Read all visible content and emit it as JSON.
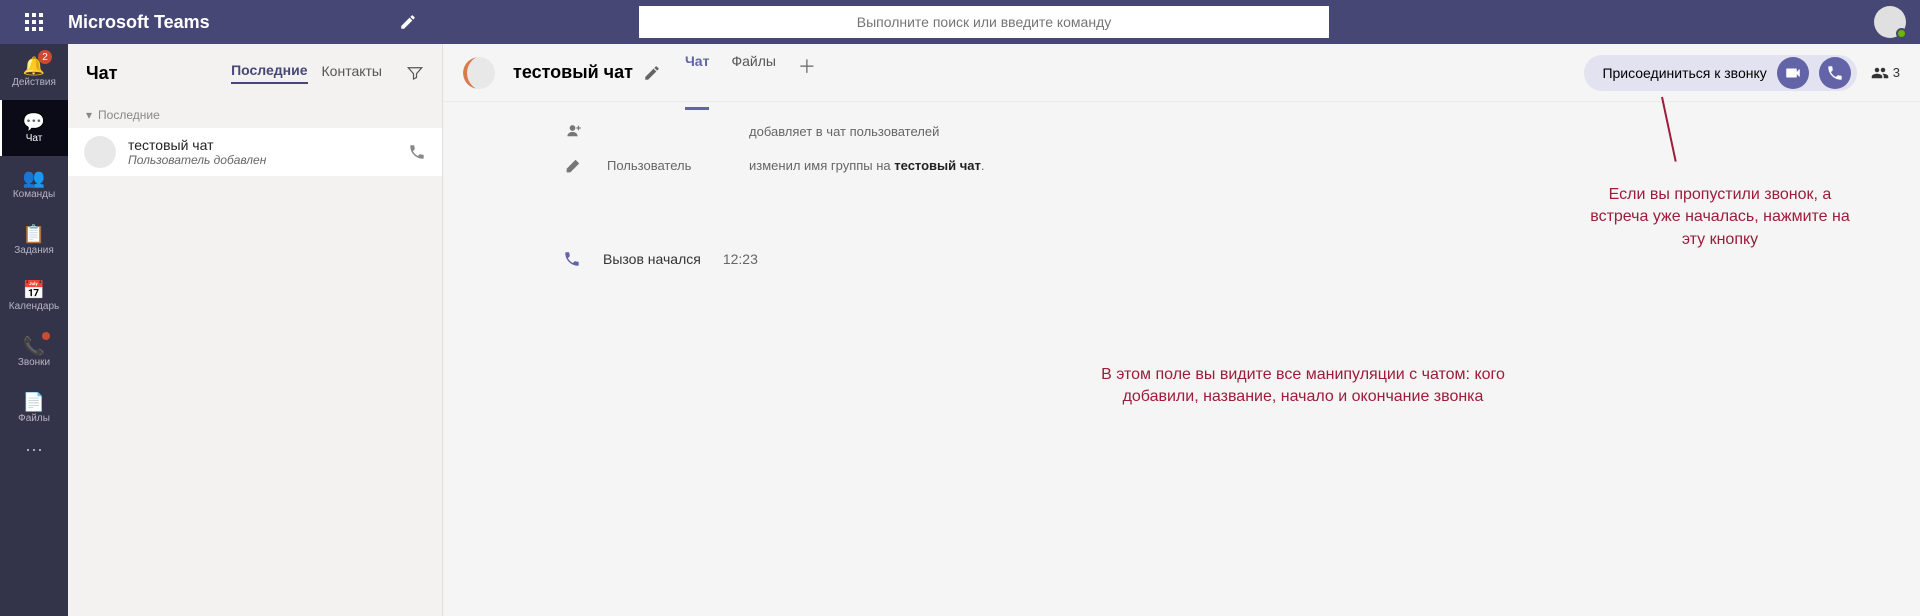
{
  "app": {
    "title": "Microsoft Teams"
  },
  "search": {
    "placeholder": "Выполните поиск или введите команду"
  },
  "rail": {
    "activity": "Действия",
    "activity_badge": "2",
    "chat": "Чат",
    "teams": "Команды",
    "assignments": "Задания",
    "calendar": "Календарь",
    "calls": "Звонки",
    "files": "Файлы"
  },
  "chatlist": {
    "title": "Чат",
    "tab_recent": "Последние",
    "tab_contacts": "Контакты",
    "section_recent": "Последние",
    "items": [
      {
        "name": "тестовый чат",
        "preview": "Пользователь добавлен"
      }
    ]
  },
  "conversation": {
    "title": "тестовый чат",
    "tab_chat": "Чат",
    "tab_files": "Файлы",
    "join_label": "Присоединиться к звонку",
    "participants": "3",
    "system": {
      "added_users": "добавляет в чат пользователей",
      "user_label": "Пользователь",
      "renamed_prefix": "изменил имя группы на ",
      "renamed_name": "тестовый чат",
      "call_started": "Вызов начался",
      "call_time": "12:23"
    }
  },
  "annotations": {
    "join_hint": "Если вы пропустили звонок, а встреча уже началась, нажмите на эту кнопку",
    "feed_hint": "В этом поле вы видите все манипуляции с чатом: кого добавили, название, начало и окончание звонка"
  }
}
